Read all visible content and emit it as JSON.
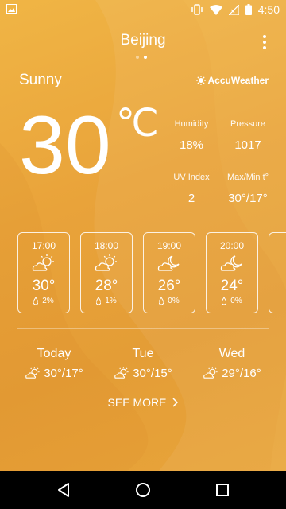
{
  "status_bar": {
    "time": "4:50"
  },
  "header": {
    "city": "Beijing",
    "page_count": 2,
    "active_page": 2
  },
  "current": {
    "condition": "Sunny",
    "provider": "AccuWeather",
    "temperature": "30",
    "unit": "℃",
    "humidity_label": "Humidity",
    "humidity": "18%",
    "pressure_label": "Pressure",
    "pressure": "1017",
    "uv_label": "UV Index",
    "uv": "2",
    "maxmin_label": "Max/Min t°",
    "maxmin": "30°/17°"
  },
  "hourly": [
    {
      "time": "17:00",
      "temp": "30°",
      "precip": "2%",
      "icon": "sun-cloud-icon"
    },
    {
      "time": "18:00",
      "temp": "28°",
      "precip": "1%",
      "icon": "sun-cloud-icon"
    },
    {
      "time": "19:00",
      "temp": "26°",
      "precip": "0%",
      "icon": "moon-cloud-icon"
    },
    {
      "time": "20:00",
      "temp": "24°",
      "precip": "0%",
      "icon": "moon-cloud-icon"
    }
  ],
  "daily": [
    {
      "day": "Today",
      "range": "30°/17°",
      "icon": "sun-cloud-icon"
    },
    {
      "day": "Tue",
      "range": "30°/15°",
      "icon": "sun-cloud-icon"
    },
    {
      "day": "Wed",
      "range": "29°/16°",
      "icon": "sun-cloud-icon"
    }
  ],
  "see_more": "SEE MORE",
  "colors": {
    "background": "#e9a33a",
    "text": "#ffffff",
    "navbar": "#000000"
  }
}
